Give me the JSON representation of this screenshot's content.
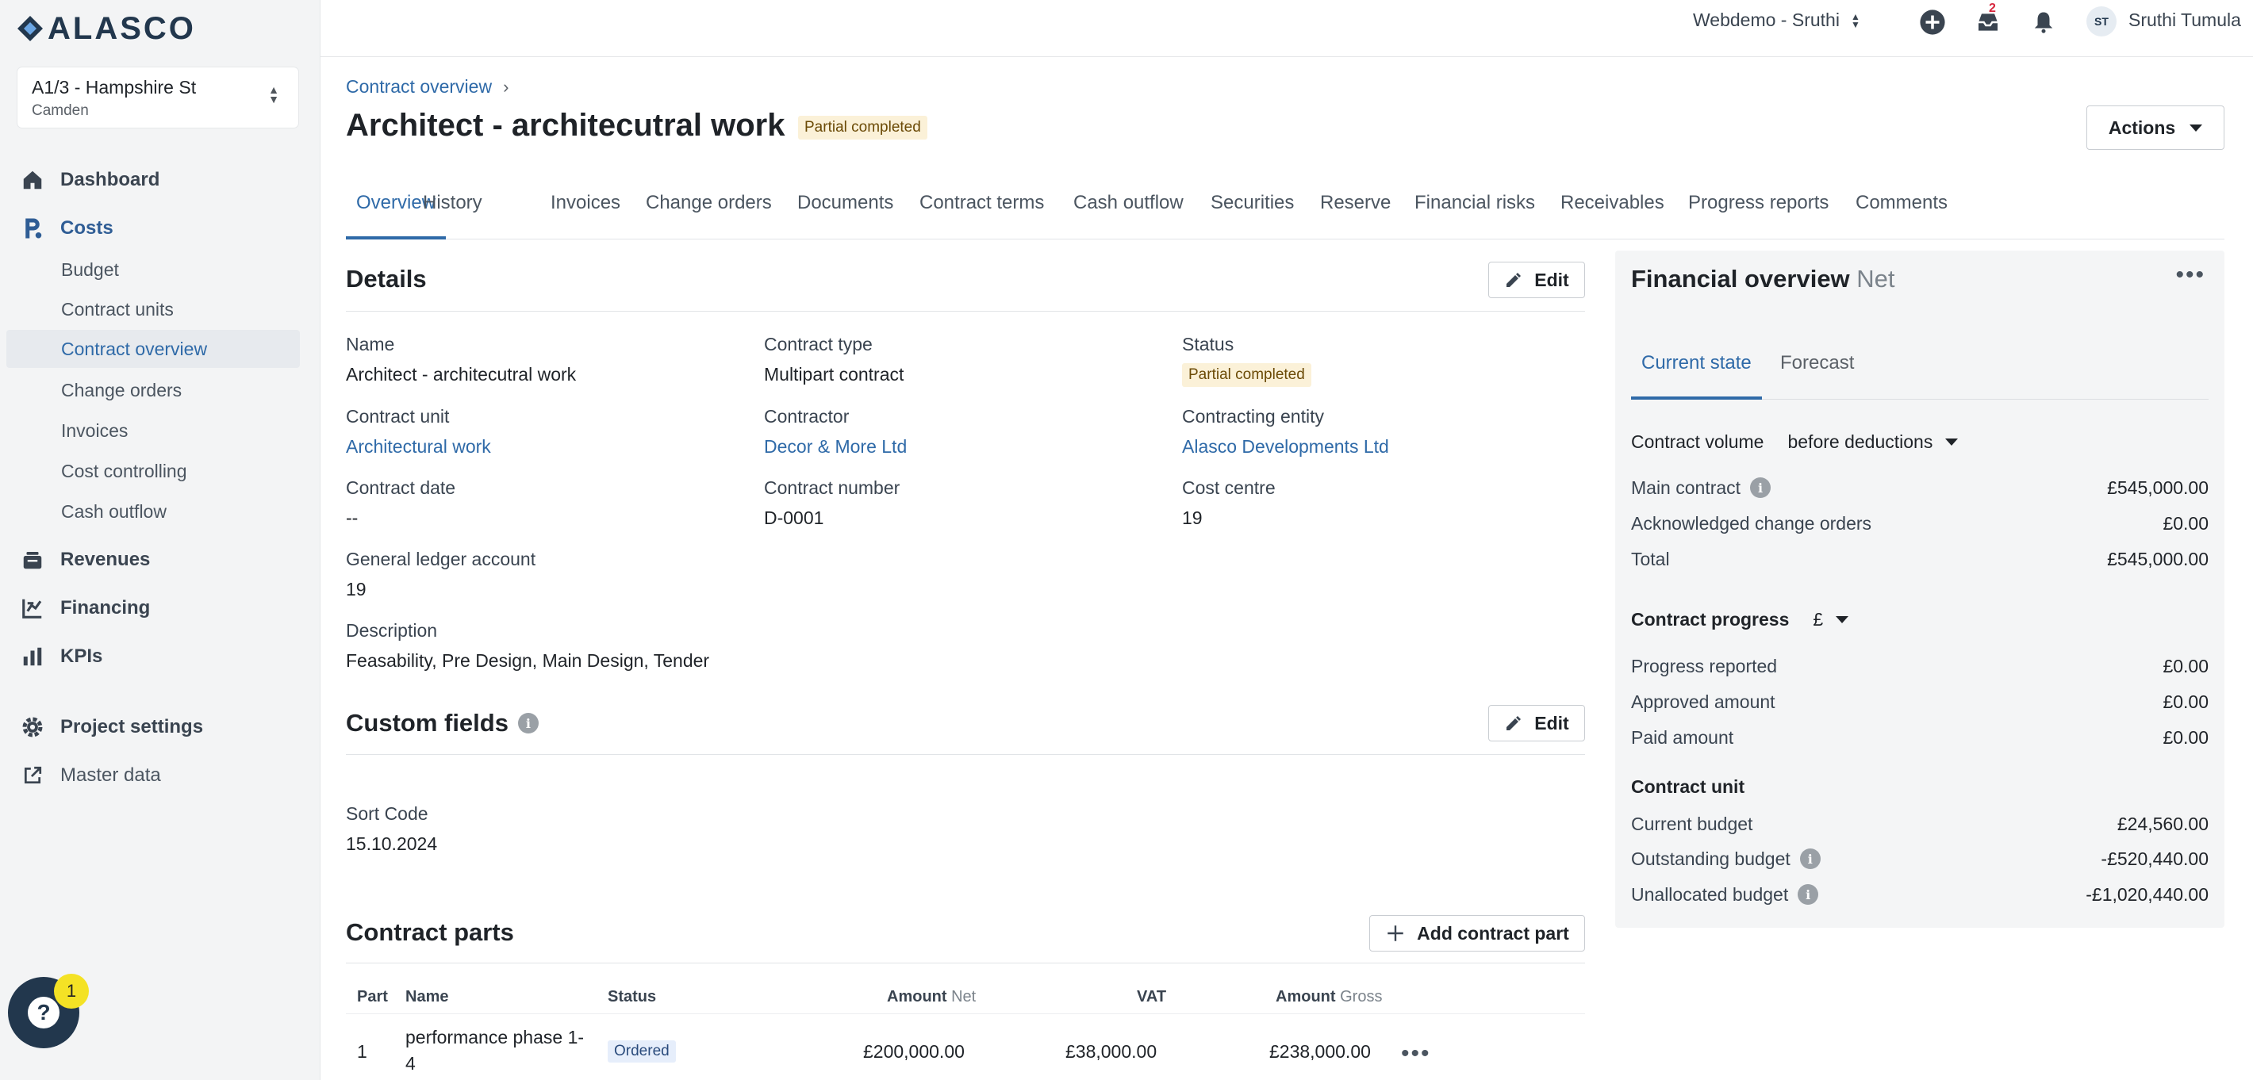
{
  "brand": {
    "logo_text": "ALASCO"
  },
  "project": {
    "name": "A1/3 - Hampshire St",
    "location": "Camden"
  },
  "nav": {
    "dashboard": "Dashboard",
    "costs": "Costs",
    "costs_items": [
      "Budget",
      "Contract units",
      "Contract overview",
      "Change orders",
      "Invoices",
      "Cost controlling",
      "Cash outflow"
    ],
    "revenues": "Revenues",
    "financing": "Financing",
    "kpis": "KPIs",
    "project_settings": "Project settings",
    "master_data": "Master data"
  },
  "help": {
    "badge_count": "1"
  },
  "topbar": {
    "workspace": "Webdemo - Sruthi",
    "inbox_badge": "2",
    "avatar_initials": "ST",
    "user_name": "Sruthi Tumula"
  },
  "breadcrumb": {
    "parent": "Contract overview"
  },
  "page": {
    "title": "Architect - architecutral work",
    "status": "Partial completed",
    "actions_label": "Actions"
  },
  "tabs": [
    "Overview",
    "History",
    "Invoices",
    "Change orders",
    "Documents",
    "Contract terms",
    "Cash outflow",
    "Securities",
    "Reserve",
    "Financial risks",
    "Receivables",
    "Progress reports",
    "Comments"
  ],
  "details": {
    "title": "Details",
    "edit_label": "Edit",
    "name_label": "Name",
    "name_value": "Architect - architecutral work",
    "contract_type_label": "Contract type",
    "contract_type_value": "Multipart contract",
    "status_label": "Status",
    "status_value": "Partial completed",
    "contract_unit_label": "Contract unit",
    "contract_unit_value": "Architectural work",
    "contractor_label": "Contractor",
    "contractor_value": "Decor & More Ltd",
    "contracting_entity_label": "Contracting entity",
    "contracting_entity_value": "Alasco Developments Ltd",
    "contract_date_label": "Contract date",
    "contract_date_value": "--",
    "contract_number_label": "Contract number",
    "contract_number_value": "D-0001",
    "cost_centre_label": "Cost centre",
    "cost_centre_value": "19",
    "gl_account_label": "General ledger account",
    "gl_account_value": "19",
    "description_label": "Description",
    "description_value": "Feasability, Pre Design, Main Design, Tender"
  },
  "custom_fields": {
    "title": "Custom fields",
    "edit_label": "Edit",
    "sort_code_label": "Sort Code",
    "sort_code_value": "15.10.2024"
  },
  "contract_parts": {
    "title": "Contract parts",
    "add_label": "Add contract part",
    "columns": {
      "part": "Part",
      "name": "Name",
      "status": "Status",
      "amount": "Amount",
      "amount_net": "Net",
      "vat": "VAT",
      "amount_gross_label": "Amount",
      "gross": "Gross"
    },
    "rows": [
      {
        "part": "1",
        "name_line1": "performance phase 1-",
        "name_line2": "4",
        "status": "Ordered",
        "amount_net": "£200,000.00",
        "vat": "£38,000.00",
        "amount_gross": "£238,000.00"
      }
    ]
  },
  "financial_overview": {
    "title": "Financial overview",
    "subtitle": "Net",
    "tabs": [
      "Current state",
      "Forecast"
    ],
    "contract_volume_label": "Contract volume",
    "contract_volume_select": "before deductions",
    "main_contract_label": "Main contract",
    "main_contract_value": "£545,000.00",
    "ack_change_orders_label": "Acknowledged change orders",
    "ack_change_orders_value": "£0.00",
    "total_label": "Total",
    "total_value": "£545,000.00",
    "contract_progress_label": "Contract progress",
    "contract_progress_select": "£",
    "progress_reported_label": "Progress reported",
    "progress_reported_value": "£0.00",
    "approved_amount_label": "Approved amount",
    "approved_amount_value": "£0.00",
    "paid_amount_label": "Paid amount",
    "paid_amount_value": "£0.00",
    "contract_unit_label": "Contract unit",
    "current_budget_label": "Current budget",
    "current_budget_value": "£24,560.00",
    "outstanding_budget_label": "Outstanding budget",
    "outstanding_budget_value": "-£520,440.00",
    "unallocated_budget_label": "Unallocated budget",
    "unallocated_budget_value": "-£1,020,440.00"
  },
  "colors": {
    "accent": "#2f6aa8",
    "sidebar_bg": "#f3f4f5",
    "brand_dark": "#22374d",
    "badge_warning_bg": "#fbf1d8",
    "notification": "#d7263d"
  },
  "icons": [
    "alasco-logo-icon",
    "chevron-up-down-icon",
    "home-icon",
    "costs-icon",
    "revenues-icon",
    "financing-icon",
    "kpis-icon",
    "gear-icon",
    "external-link-icon",
    "help-icon",
    "plus-circle-icon",
    "inbox-icon",
    "bell-icon",
    "pencil-icon",
    "info-icon",
    "plus-icon",
    "more-horizontal-icon",
    "caret-down-icon"
  ]
}
